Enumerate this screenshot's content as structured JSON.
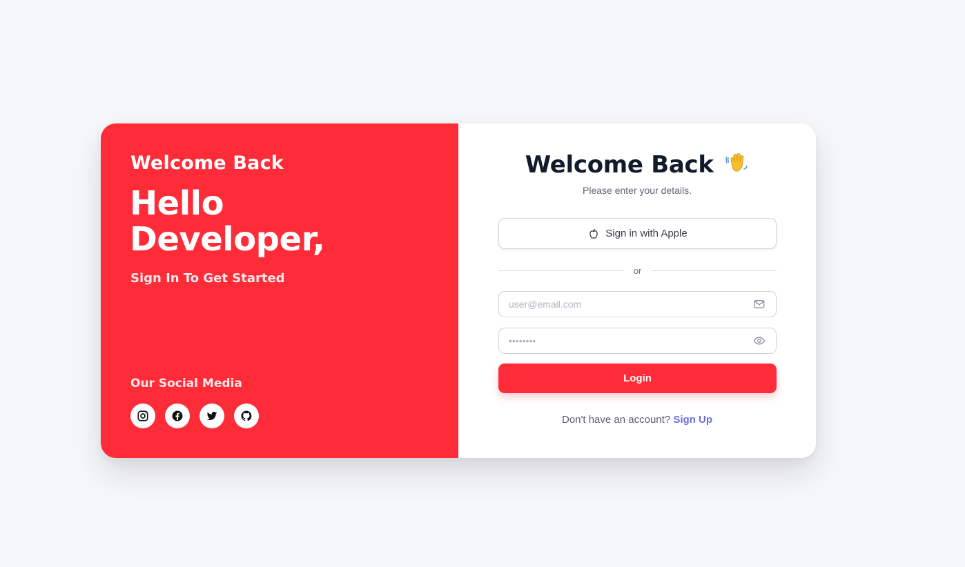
{
  "left_panel": {
    "kicker": "Welcome Back",
    "greeting_line1": "Hello",
    "greeting_line2": "Developer,",
    "tagline": "Sign In To Get Started",
    "social_title": "Our Social Media",
    "social_icons": [
      "instagram-icon",
      "facebook-icon",
      "twitter-icon",
      "github-icon"
    ],
    "background_color": "#fe2c39"
  },
  "right_panel": {
    "title": "Welcome Back",
    "title_emoji": "waving-hand-icon",
    "subtitle": "Please enter your details.",
    "apple_button_label": "Sign in with Apple",
    "divider_label": "or",
    "email_placeholder": "user@email.com",
    "password_placeholder": "••••••••",
    "login_label": "Login",
    "signup_prompt": "Don't have an account?",
    "signup_link": "Sign Up",
    "accent_color": "#fe2c39",
    "link_color": "#6a6fdc"
  }
}
